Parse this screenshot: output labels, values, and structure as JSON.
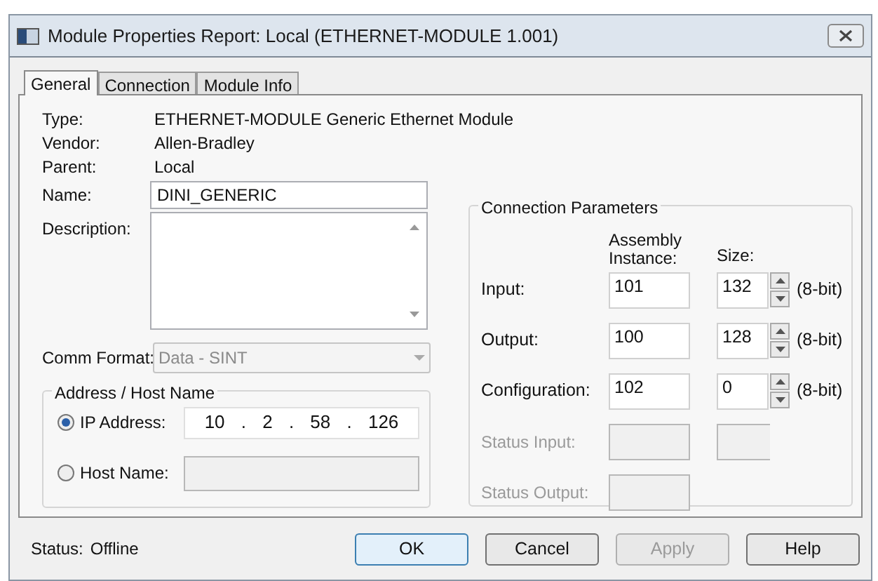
{
  "window": {
    "title": "Module Properties Report: Local (ETHERNET-MODULE 1.001)"
  },
  "tabs": [
    {
      "label": "General",
      "selected": true
    },
    {
      "label": "Connection",
      "selected": false
    },
    {
      "label": "Module Info",
      "selected": false
    }
  ],
  "general": {
    "fields": [
      {
        "label": "Type:",
        "value": "ETHERNET-MODULE Generic Ethernet Module"
      },
      {
        "label": "Vendor:",
        "value": "Allen-Bradley"
      },
      {
        "label": "Parent:",
        "value": "Local"
      }
    ],
    "name": {
      "label": "Name:",
      "value": "DINI_GENERIC"
    },
    "description": {
      "label": "Description:"
    },
    "comm_format": {
      "label": "Comm Format:",
      "value": "Data - SINT",
      "disabled": true
    },
    "address": {
      "title": "Address / Host Name",
      "options": [
        {
          "kind": "ip",
          "label": "IP Address:",
          "selected": true,
          "value": "10 . 2 . 58 . 126"
        },
        {
          "kind": "text",
          "label": "Host Name:",
          "selected": false
        }
      ]
    }
  },
  "connection_parameters": {
    "title": "Connection Parameters",
    "instance_header": "Assembly Instance:",
    "size_header": "Size:",
    "rows": [
      {
        "kind": "sized",
        "label": "Input:",
        "instance": "101",
        "size": "132",
        "unit": "(8-bit)",
        "disabled": false
      },
      {
        "kind": "sized",
        "label": "Output:",
        "instance": "100",
        "size": "128",
        "unit": "(8-bit)",
        "disabled": false
      },
      {
        "kind": "sized",
        "label": "Configuration:",
        "instance": "102",
        "size": "0",
        "unit": "(8-bit)",
        "disabled": false
      },
      {
        "kind": "status_pair",
        "label": "Status Input:",
        "disabled": true
      },
      {
        "kind": "status_single",
        "label": "Status Output:",
        "disabled": true
      }
    ]
  },
  "status": {
    "label": "Status:",
    "value": "Offline"
  },
  "buttons": [
    {
      "label": "OK",
      "default": true,
      "disabled": false
    },
    {
      "label": "Cancel",
      "default": false,
      "disabled": false
    },
    {
      "label": "Apply",
      "default": false,
      "disabled": true
    },
    {
      "label": "Help",
      "default": false,
      "disabled": false
    }
  ]
}
